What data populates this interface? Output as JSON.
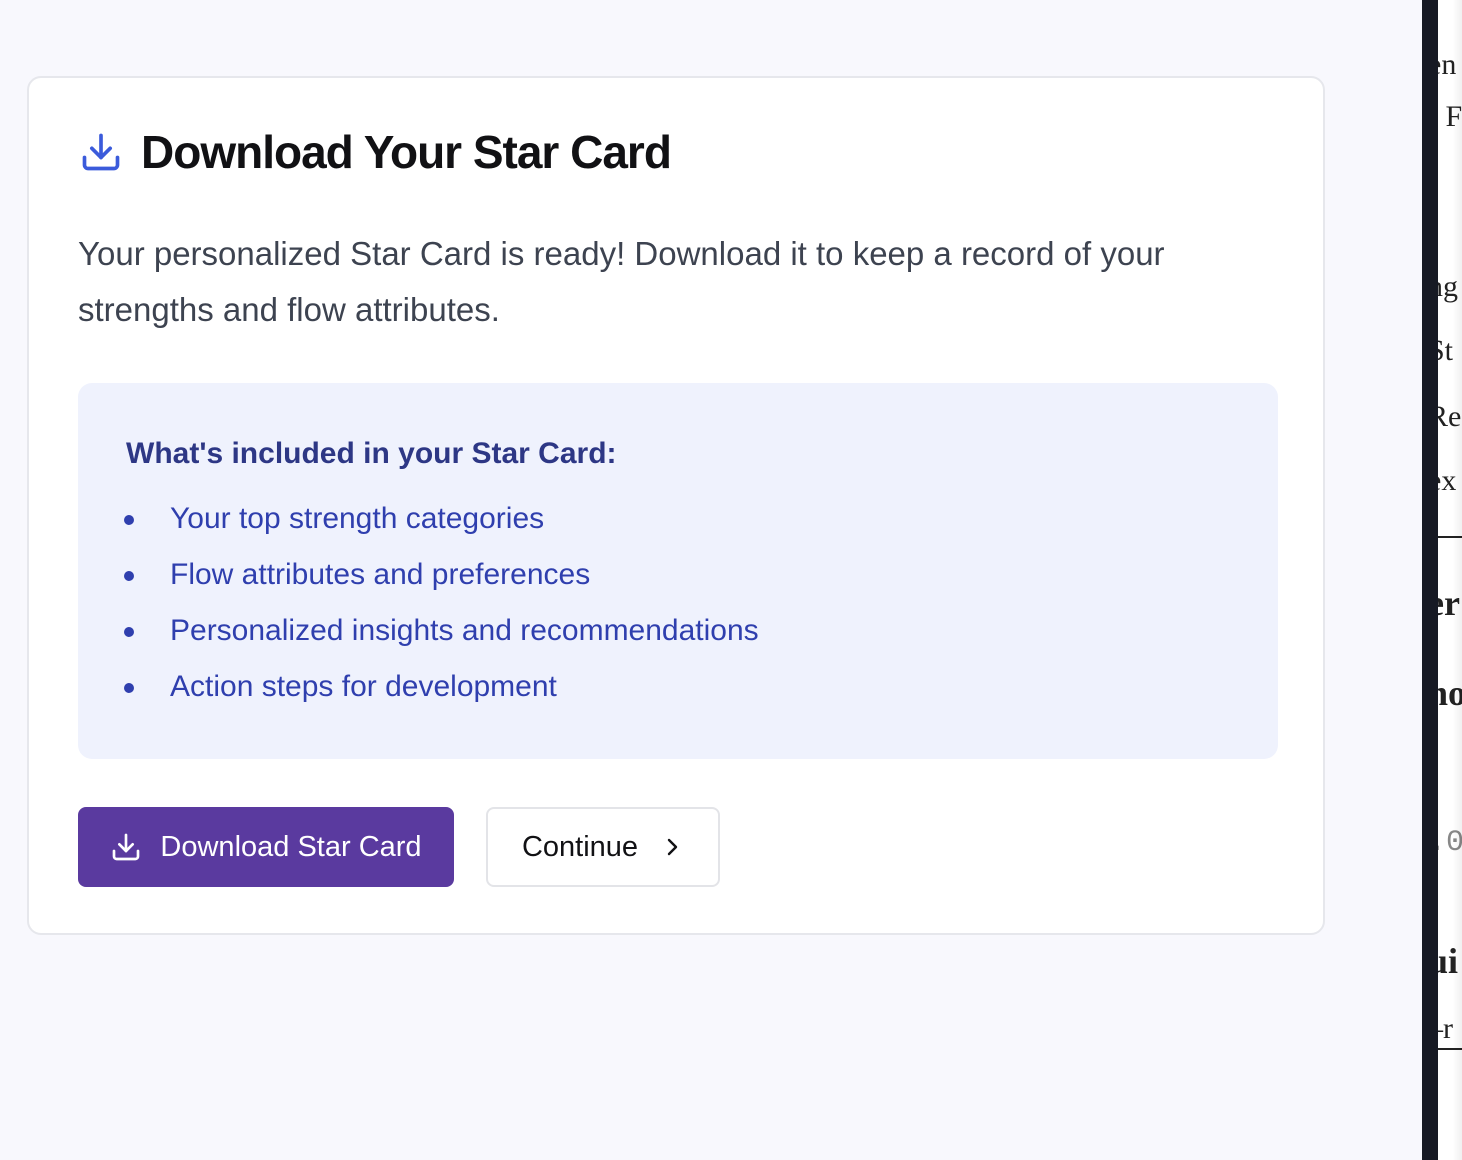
{
  "card": {
    "title": "Download Your Star Card",
    "description": "Your personalized Star Card is ready! Download it to keep a record of your strengths and flow attributes.",
    "included": {
      "heading": "What's included in your Star Card:",
      "items": [
        "Your top strength categories",
        "Flow attributes and preferences",
        "Personalized insights and recommendations",
        "Action steps for development"
      ]
    },
    "actions": {
      "download_label": "Download Star Card",
      "continue_label": "Continue"
    }
  },
  "side_pane": {
    "fragments": [
      "en",
      "[ F",
      "ng",
      "St",
      "Re",
      "ex",
      "er",
      "no",
      ".0",
      "ui",
      "–r"
    ]
  },
  "icons": {
    "header_icon": "download-icon",
    "download_button_icon": "download-icon",
    "continue_icon": "chevron-right-icon"
  },
  "colors": {
    "page_bg": "#f8f8fd",
    "accent_blue": "#3b5bdb",
    "primary_button": "#5a3a9f",
    "included_bg": "#eff2fd",
    "included_text": "#2f3fae",
    "included_heading": "#2d3785"
  }
}
